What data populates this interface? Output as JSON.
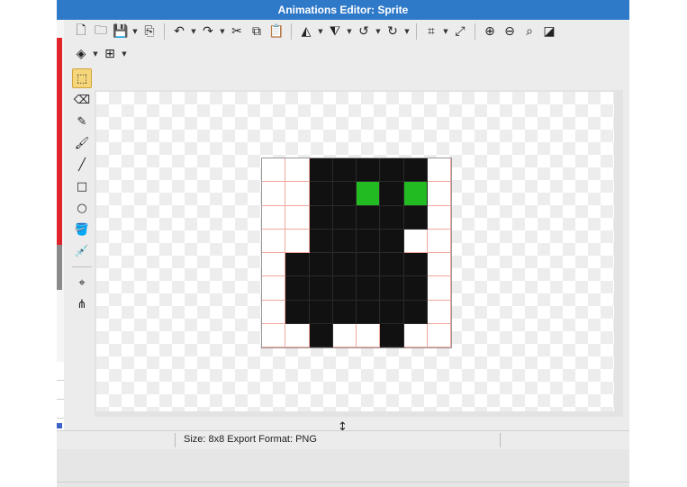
{
  "window": {
    "title": "Animations Editor: Sprite"
  },
  "toolbar": {
    "row1": [
      {
        "name": "new-file-icon",
        "glyph": "🗋"
      },
      {
        "name": "open-folder-icon",
        "glyph": "🗀"
      },
      {
        "name": "save-icon",
        "glyph": "💾",
        "dropdown": true
      },
      {
        "name": "export-icon",
        "glyph": "⎘"
      },
      {
        "sep": true
      },
      {
        "name": "undo-icon",
        "glyph": "↶",
        "dropdown": true
      },
      {
        "name": "redo-icon",
        "glyph": "↷",
        "dropdown": true
      },
      {
        "name": "cut-icon",
        "glyph": "✂"
      },
      {
        "name": "copy-icon",
        "glyph": "⧉"
      },
      {
        "name": "paste-icon",
        "glyph": "📋"
      },
      {
        "sep": true
      },
      {
        "name": "flip-horizontal-icon",
        "glyph": "◭",
        "dropdown": true
      },
      {
        "name": "flip-vertical-icon",
        "glyph": "⧨",
        "dropdown": true
      },
      {
        "name": "rotate-ccw-icon",
        "glyph": "↺",
        "dropdown": true
      },
      {
        "name": "rotate-cw-icon",
        "glyph": "↻",
        "dropdown": true
      },
      {
        "sep": true
      },
      {
        "name": "crop-icon",
        "glyph": "⌗",
        "dropdown": true
      },
      {
        "name": "resize-icon",
        "glyph": "⤢"
      },
      {
        "sep": true
      },
      {
        "name": "zoom-in-icon",
        "glyph": "⊕"
      },
      {
        "name": "zoom-out-icon",
        "glyph": "⊖"
      },
      {
        "name": "zoom-fit-icon",
        "glyph": "⌕"
      },
      {
        "name": "contrast-icon",
        "glyph": "◪"
      }
    ],
    "row2": [
      {
        "name": "layers-icon",
        "glyph": "◈",
        "dropdown": true
      },
      {
        "name": "grid-icon",
        "glyph": "⊞",
        "dropdown": true
      }
    ]
  },
  "tools": [
    {
      "name": "marquee-select-icon",
      "glyph": "⬚",
      "active": true
    },
    {
      "name": "eraser-icon",
      "glyph": "⌫"
    },
    {
      "name": "pencil-icon",
      "glyph": "✎"
    },
    {
      "name": "brush-icon",
      "glyph": "🖌"
    },
    {
      "name": "line-icon",
      "glyph": "╱"
    },
    {
      "name": "rectangle-icon",
      "glyph": "□"
    },
    {
      "name": "ellipse-icon",
      "glyph": "○"
    },
    {
      "name": "fill-bucket-icon",
      "glyph": "🪣"
    },
    {
      "name": "eyedropper-icon",
      "glyph": "💉"
    },
    {
      "sep": true
    },
    {
      "name": "anchor-point-icon",
      "glyph": "⌖"
    },
    {
      "name": "node-tree-icon",
      "glyph": "⋔"
    }
  ],
  "sprite": {
    "width": 8,
    "height": 8,
    "colors": {
      "0": "#ffffff",
      "1": "#111111",
      "2": "#22bb22"
    },
    "pixels": [
      [
        0,
        0,
        1,
        1,
        1,
        1,
        1,
        0
      ],
      [
        0,
        0,
        1,
        1,
        2,
        1,
        2,
        0
      ],
      [
        0,
        0,
        1,
        1,
        1,
        1,
        1,
        0
      ],
      [
        0,
        0,
        1,
        1,
        1,
        1,
        0,
        0
      ],
      [
        0,
        1,
        1,
        1,
        1,
        1,
        1,
        0
      ],
      [
        0,
        1,
        1,
        1,
        1,
        1,
        1,
        0
      ],
      [
        0,
        1,
        1,
        1,
        1,
        1,
        1,
        0
      ],
      [
        0,
        0,
        1,
        0,
        0,
        1,
        0,
        0
      ]
    ]
  },
  "status": {
    "text": "Size: 8x8   Export Format: PNG"
  }
}
